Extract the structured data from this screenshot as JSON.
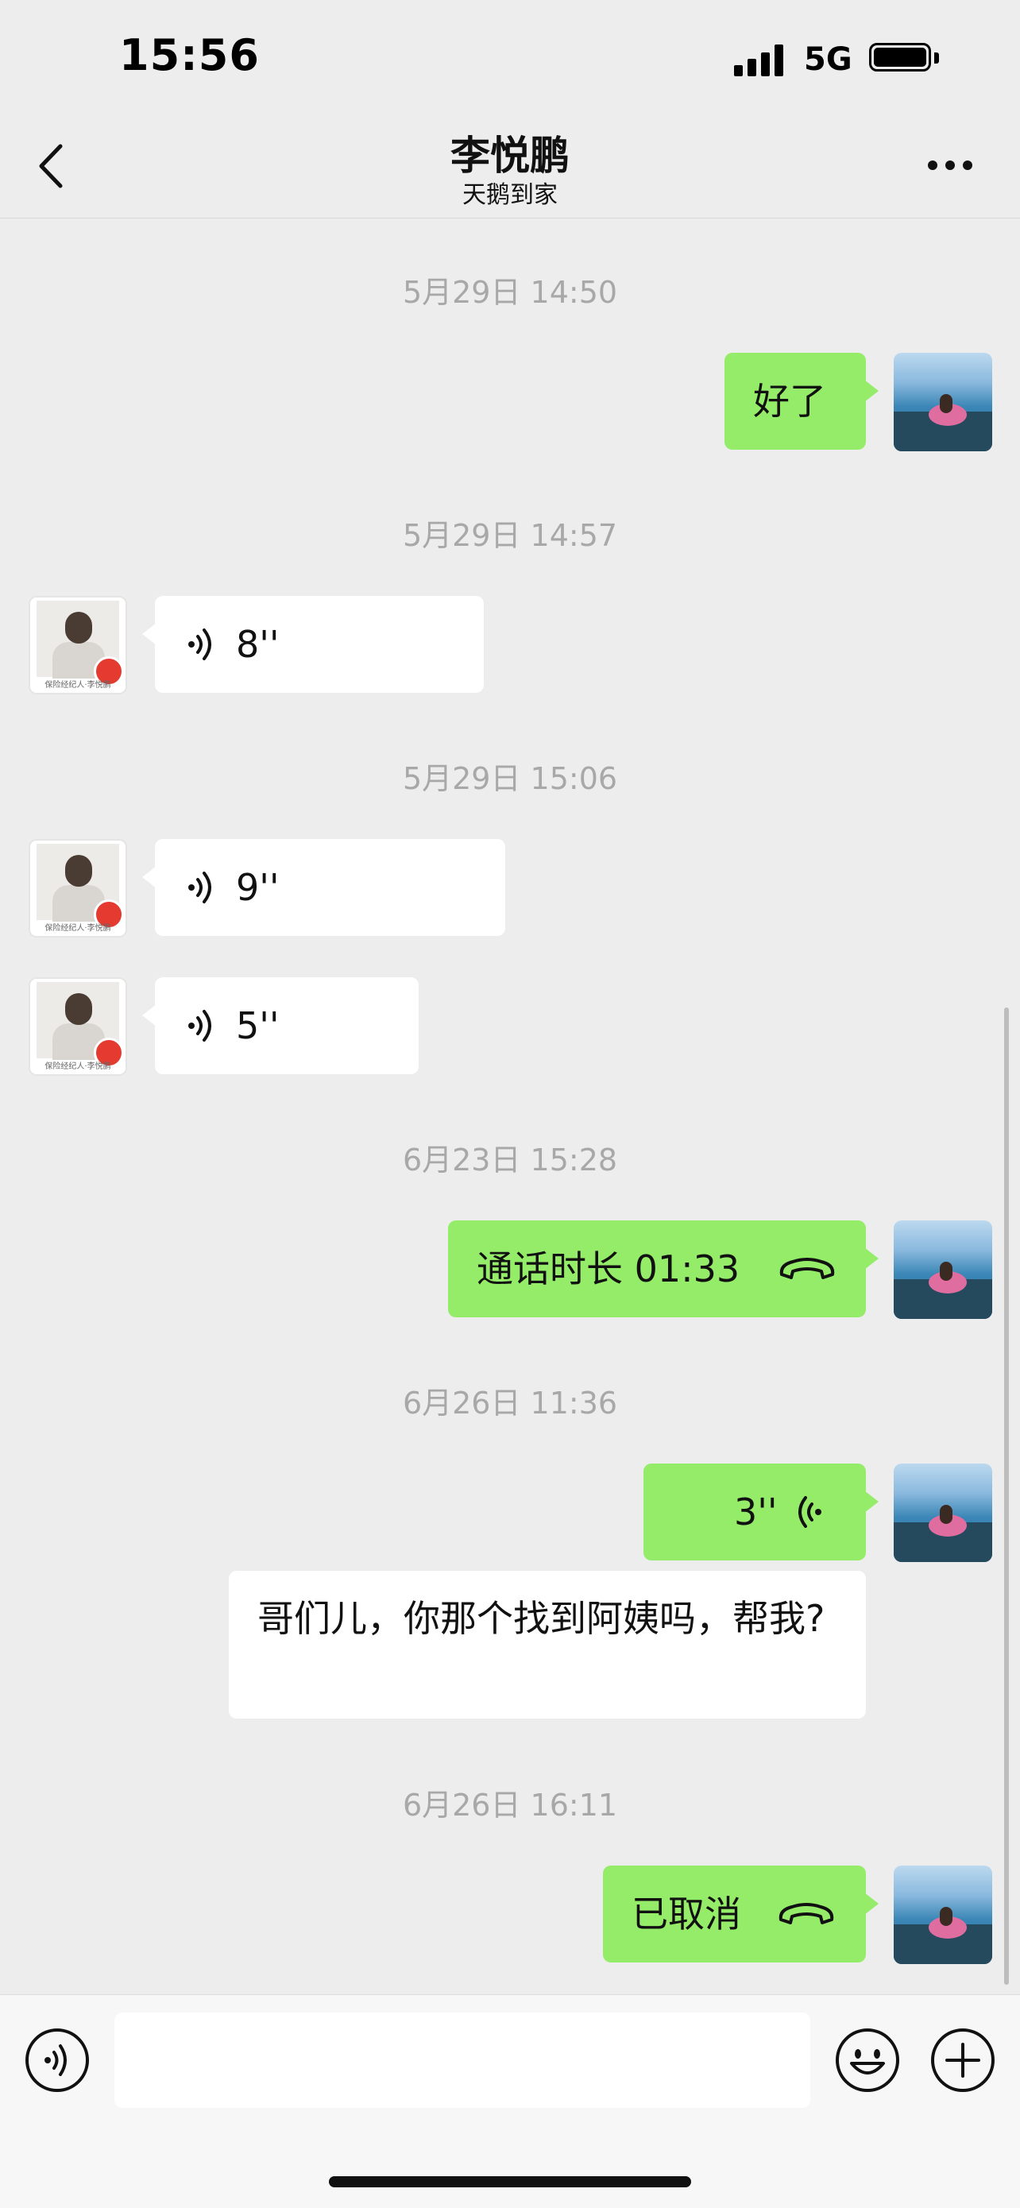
{
  "status_bar": {
    "time": "15:56",
    "network": "5G"
  },
  "header": {
    "title": "李悦鹏",
    "subtitle": "天鹅到家"
  },
  "messages": [
    {
      "timestamp": "5月29日 14:50"
    },
    {
      "from": "me",
      "type": "text",
      "text": "好了"
    },
    {
      "timestamp": "5月29日 14:57"
    },
    {
      "from": "them",
      "type": "voice",
      "duration": "8''"
    },
    {
      "timestamp": "5月29日 15:06"
    },
    {
      "from": "them",
      "type": "voice",
      "duration": "9''"
    },
    {
      "from": "them",
      "type": "voice",
      "duration": "5''"
    },
    {
      "timestamp": "6月23日 15:28"
    },
    {
      "from": "me",
      "type": "call",
      "text": "通话时长 01:33"
    },
    {
      "timestamp": "6月26日 11:36"
    },
    {
      "from": "me",
      "type": "voice",
      "duration": "3''"
    },
    {
      "from": "me",
      "type": "text",
      "text": "哥们儿，你那个找到阿姨吗，帮我?"
    },
    {
      "timestamp": "6月26日 16:11"
    },
    {
      "from": "me",
      "type": "call",
      "text": "已取消"
    }
  ],
  "contact_avatar_caption": "保险经纪人·李悦鹏",
  "input_bar": {
    "placeholder": ""
  },
  "colors": {
    "background": "#ededed",
    "my_bubble": "#95ec69",
    "their_bubble": "#ffffff",
    "timestamp": "#a8a8a8"
  },
  "icons": [
    "back-icon",
    "more-icon",
    "voice-icon",
    "phone-icon",
    "voice-input-icon",
    "emoji-icon",
    "add-icon"
  ]
}
